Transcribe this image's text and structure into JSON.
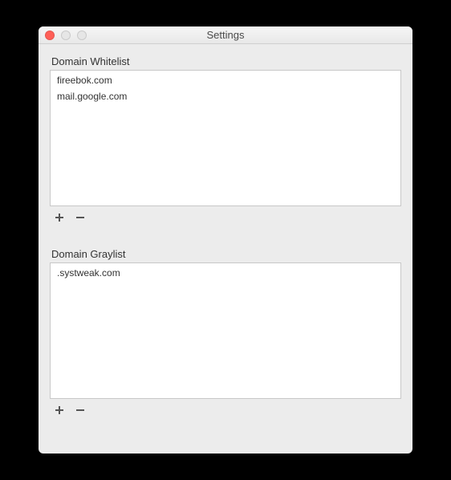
{
  "window": {
    "title": "Settings"
  },
  "whitelist": {
    "label": "Domain Whitelist",
    "items": [
      "fireebok.com",
      "mail.google.com"
    ]
  },
  "graylist": {
    "label": "Domain Graylist",
    "items": [
      ".systweak.com"
    ]
  },
  "icons": {
    "add": "plus-icon",
    "remove": "minus-icon"
  }
}
